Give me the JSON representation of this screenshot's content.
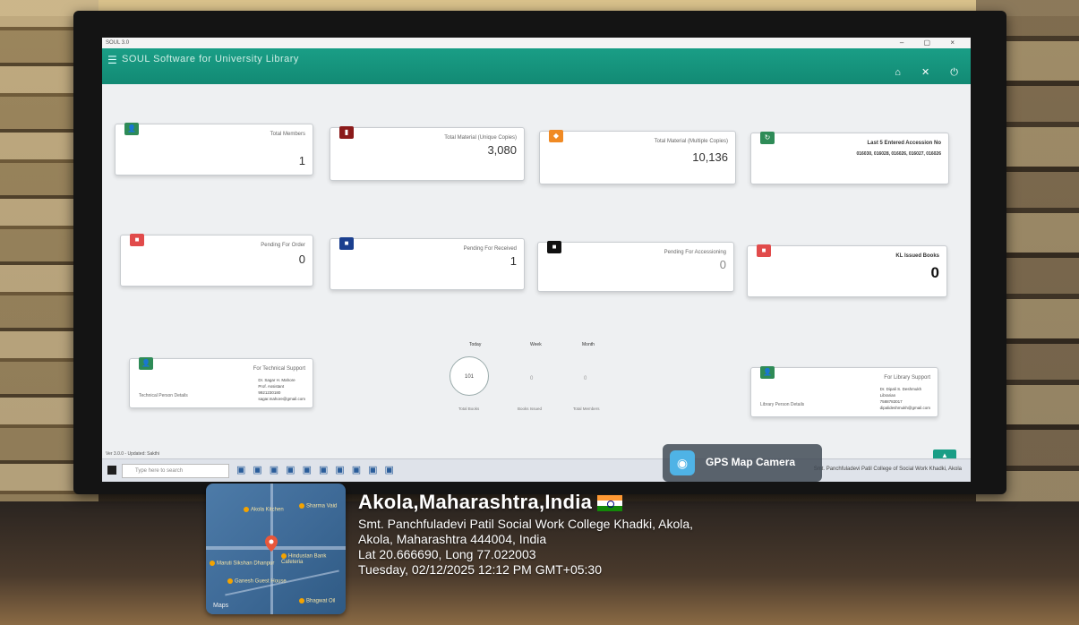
{
  "window": {
    "title": "SOUL 3.0",
    "controls": [
      "–",
      "▢",
      "×"
    ]
  },
  "app": {
    "title": "SOUL Software for University Library",
    "menu_icon": "hamburger-icon",
    "header_icons": [
      "home-icon",
      "close-icon",
      "power-icon"
    ]
  },
  "cards": {
    "total_members": {
      "label": "Total Members",
      "value": "1",
      "color": "#2e8b57",
      "icon": "user-icon"
    },
    "total_material_unique": {
      "label": "Total Material (Unique Copies)",
      "value": "3,080",
      "color": "#8b1a1a",
      "icon": "book-icon"
    },
    "total_material_multiple": {
      "label": "Total Material (Multiple Copies)",
      "value": "10,136",
      "color": "#f08a24",
      "icon": "stack-icon"
    },
    "last_accession": {
      "label": "Last 5 Entered Accession No",
      "sub": "016030, 016028, 016026, 016027, 016026",
      "color": "#2e8b57",
      "icon": "refresh-icon"
    },
    "pending_order": {
      "label": "Pending For Order",
      "value": "0",
      "color": "#e14b4b",
      "icon": "cart-icon"
    },
    "pending_received": {
      "label": "Pending For Received",
      "value": "1",
      "color": "#1b3f8f",
      "icon": "inbox-icon"
    },
    "pending_accessioning": {
      "label": "Pending For Accessioning",
      "value": "0",
      "color": "#111111",
      "icon": "file-icon"
    },
    "issued_books": {
      "label": "KL Issued Books",
      "value": "0",
      "color": "#e14b4b",
      "icon": "issue-icon"
    }
  },
  "technical_support": {
    "title": "For Technical Support",
    "link": "Technical Person Details",
    "info": [
      "Dr. Sagar H. Mahore",
      "Prof. Assistant",
      "9921230180",
      "sagar.mahore@gmail.com"
    ],
    "color": "#2e8b57"
  },
  "library_support": {
    "title": "For Library Support",
    "link": "Library Person Details",
    "info": [
      "Dr. Dipali S. Deshmukh",
      "Librarian",
      "7588783017",
      "dipalideshmukh@gmail.com"
    ],
    "color": "#2e8b57"
  },
  "stats": {
    "tabs": [
      "Today",
      "Week",
      "Month"
    ],
    "circle_value": "101",
    "values": [
      "0",
      "0"
    ],
    "captions": [
      "Total Books",
      "Books Issued",
      "Total Members"
    ]
  },
  "status_line": "Ver 3.0.0 - Updated: Sakthi",
  "taskbar": {
    "search_placeholder": "Type here to search",
    "right_text": "Smt. Panchfuladevi Patil College of Social Work Khadki, Akola"
  },
  "gps_tag": {
    "label": "GPS Map Camera"
  },
  "map": {
    "pois": [
      "Akola Kitchen",
      "Sharma Vaid",
      "Hindustan Bank Cafeteria",
      "Maruti Sikshan Dhanpur",
      "Ganesh Guest House",
      "Bhagwat Oil"
    ],
    "brand": "Maps"
  },
  "geo": {
    "title": "Akola,Maharashtra,India",
    "place": "Smt. Panchfuladevi Patil Social Work College Khadki, Akola,",
    "address": "Akola, Maharashtra 444004, India",
    "coords": "Lat 20.666690, Long 77.022003",
    "datetime": "Tuesday, 02/12/2025 12:12 PM GMT+05:30"
  }
}
